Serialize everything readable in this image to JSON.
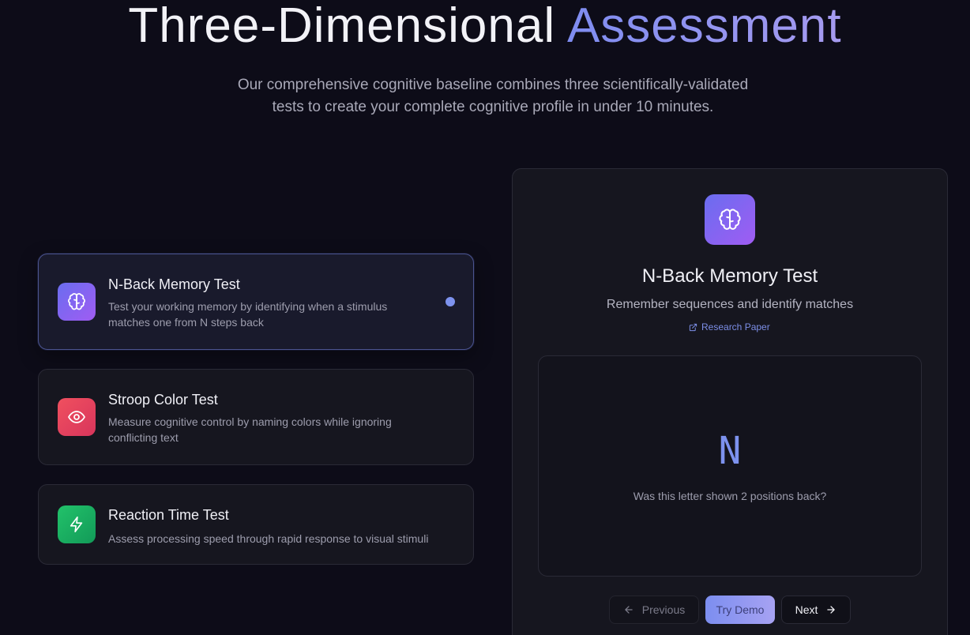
{
  "hero": {
    "title_main": "Three-Dimensional",
    "title_accent": "Assessment",
    "subtitle_line1": "Our comprehensive cognitive baseline combines three scientifically-validated",
    "subtitle_line2": "tests to create your complete cognitive profile in under 10 minutes."
  },
  "tests": [
    {
      "title": "N-Back Memory Test",
      "desc_line1": "Test your working memory by identifying when a stimulus",
      "desc_line2": "matches one from N steps back",
      "icon": "brain-icon",
      "gradient": [
        "#6a6df0",
        "#a05cf2"
      ],
      "active": true
    },
    {
      "title": "Stroop Color Test",
      "desc_line1": "Measure cognitive control by naming colors while ignoring",
      "desc_line2": "conflicting text",
      "icon": "eye-icon",
      "gradient": [
        "#f0505f",
        "#d8355c"
      ],
      "active": false
    },
    {
      "title": "Reaction Time Test",
      "desc_line1": "Assess processing speed through rapid response to visual stimuli",
      "desc_line2": "",
      "icon": "lightning-icon",
      "gradient": [
        "#22c26a",
        "#129a58"
      ],
      "active": false
    }
  ],
  "preview": {
    "icon": "brain-icon",
    "title": "N-Back Memory Test",
    "subtitle": "Remember sequences and identify matches",
    "link_label": "Research Paper",
    "demo_letter": "N",
    "demo_question": "Was this letter shown 2 positions back?",
    "buttons": {
      "previous": "Previous",
      "try_demo": "Try Demo",
      "next": "Next"
    }
  },
  "colors": {
    "background": "#0d0c18",
    "accent": "#7d92ee"
  }
}
